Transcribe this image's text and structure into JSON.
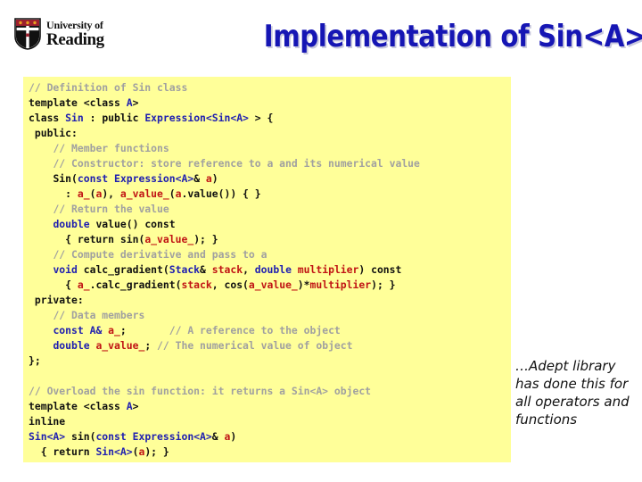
{
  "slide": {
    "title": "Implementation of Sin<A>",
    "title_color": "#1616b4",
    "title_shadow_color": "#c9c9dd",
    "background_color": "#ffffff"
  },
  "logo": {
    "name": "university-of-reading-logo",
    "line1": "University of",
    "line2": "Reading",
    "crest_colors": {
      "shield_red": "#9c1f2e",
      "shield_black": "#111111",
      "shield_white": "#ffffff",
      "gold": "#e8a020"
    }
  },
  "code_panel": {
    "background_color": "#ffff99",
    "language": "cpp",
    "colors": {
      "comment": "#a0a0a0",
      "keyword": "#101010",
      "type": "#2020b0",
      "variable": "#c01414"
    },
    "lines": [
      {
        "id": 1,
        "tokens": [
          {
            "t": "// Definition of Sin class",
            "c": "com"
          }
        ]
      },
      {
        "id": 2,
        "tokens": [
          {
            "t": "template ",
            "c": "kw"
          },
          {
            "t": "<class ",
            "c": "kw"
          },
          {
            "t": "A",
            "c": "type"
          },
          {
            "t": ">",
            "c": "kw"
          }
        ]
      },
      {
        "id": 3,
        "tokens": [
          {
            "t": "class ",
            "c": "kw"
          },
          {
            "t": "Sin",
            "c": "type"
          },
          {
            "t": " : ",
            "c": "kw"
          },
          {
            "t": "public ",
            "c": "kw"
          },
          {
            "t": "Expression<Sin<A>",
            "c": "type"
          },
          {
            "t": " > {",
            "c": "kw"
          }
        ]
      },
      {
        "id": 4,
        "tokens": [
          {
            "t": " public:",
            "c": "kw"
          }
        ]
      },
      {
        "id": 5,
        "tokens": [
          {
            "t": "    ",
            "c": "pl"
          },
          {
            "t": "// Member functions",
            "c": "com"
          }
        ]
      },
      {
        "id": 6,
        "tokens": [
          {
            "t": "    ",
            "c": "pl"
          },
          {
            "t": "// Constructor: store reference to a and its numerical value",
            "c": "com"
          }
        ]
      },
      {
        "id": 7,
        "tokens": [
          {
            "t": "    ",
            "c": "pl"
          },
          {
            "t": "Sin",
            "c": "kw"
          },
          {
            "t": "(",
            "c": "kw"
          },
          {
            "t": "const ",
            "c": "type"
          },
          {
            "t": "Expression<A>",
            "c": "type"
          },
          {
            "t": "& ",
            "c": "kw"
          },
          {
            "t": "a",
            "c": "var"
          },
          {
            "t": ")",
            "c": "kw"
          }
        ]
      },
      {
        "id": 8,
        "tokens": [
          {
            "t": "      : ",
            "c": "kw"
          },
          {
            "t": "a_",
            "c": "var"
          },
          {
            "t": "(",
            "c": "kw"
          },
          {
            "t": "a",
            "c": "var"
          },
          {
            "t": "), ",
            "c": "kw"
          },
          {
            "t": "a_value_",
            "c": "var"
          },
          {
            "t": "(",
            "c": "kw"
          },
          {
            "t": "a",
            "c": "var"
          },
          {
            "t": ".value()) { }",
            "c": "kw"
          }
        ]
      },
      {
        "id": 9,
        "tokens": [
          {
            "t": "    ",
            "c": "pl"
          },
          {
            "t": "// Return the value",
            "c": "com"
          }
        ]
      },
      {
        "id": 10,
        "tokens": [
          {
            "t": "    ",
            "c": "pl"
          },
          {
            "t": "double ",
            "c": "type"
          },
          {
            "t": "value() const",
            "c": "kw"
          }
        ]
      },
      {
        "id": 11,
        "tokens": [
          {
            "t": "      { return sin(",
            "c": "kw"
          },
          {
            "t": "a_value_",
            "c": "var"
          },
          {
            "t": "); }",
            "c": "kw"
          }
        ]
      },
      {
        "id": 12,
        "tokens": [
          {
            "t": "    ",
            "c": "pl"
          },
          {
            "t": "// Compute derivative and pass to a",
            "c": "com"
          }
        ]
      },
      {
        "id": 13,
        "tokens": [
          {
            "t": "    ",
            "c": "pl"
          },
          {
            "t": "void ",
            "c": "type"
          },
          {
            "t": "calc_gradient(",
            "c": "kw"
          },
          {
            "t": "Stack",
            "c": "type"
          },
          {
            "t": "& ",
            "c": "kw"
          },
          {
            "t": "stack",
            "c": "var"
          },
          {
            "t": ", ",
            "c": "kw"
          },
          {
            "t": "double ",
            "c": "type"
          },
          {
            "t": "multiplier",
            "c": "var"
          },
          {
            "t": ") const",
            "c": "kw"
          }
        ]
      },
      {
        "id": 14,
        "tokens": [
          {
            "t": "      { ",
            "c": "kw"
          },
          {
            "t": "a_",
            "c": "var"
          },
          {
            "t": ".calc_gradient(",
            "c": "kw"
          },
          {
            "t": "stack",
            "c": "var"
          },
          {
            "t": ", cos(",
            "c": "kw"
          },
          {
            "t": "a_value_",
            "c": "var"
          },
          {
            "t": ")*",
            "c": "kw"
          },
          {
            "t": "multiplier",
            "c": "var"
          },
          {
            "t": "); }",
            "c": "kw"
          }
        ]
      },
      {
        "id": 15,
        "tokens": [
          {
            "t": " private:",
            "c": "kw"
          }
        ]
      },
      {
        "id": 16,
        "tokens": [
          {
            "t": "    ",
            "c": "pl"
          },
          {
            "t": "// Data members",
            "c": "com"
          }
        ]
      },
      {
        "id": 17,
        "tokens": [
          {
            "t": "    ",
            "c": "pl"
          },
          {
            "t": "const ",
            "c": "type"
          },
          {
            "t": "A&",
            "c": "type"
          },
          {
            "t": " ",
            "c": "kw"
          },
          {
            "t": "a_",
            "c": "var"
          },
          {
            "t": ";",
            "c": "kw"
          },
          {
            "t": "       ",
            "c": "pl"
          },
          {
            "t": "// A reference to the object",
            "c": "com"
          }
        ]
      },
      {
        "id": 18,
        "tokens": [
          {
            "t": "    ",
            "c": "pl"
          },
          {
            "t": "double ",
            "c": "type"
          },
          {
            "t": "a_value_",
            "c": "var"
          },
          {
            "t": "; ",
            "c": "kw"
          },
          {
            "t": "// The numerical value of object",
            "c": "com"
          }
        ]
      },
      {
        "id": 19,
        "tokens": [
          {
            "t": "};",
            "c": "kw"
          }
        ]
      },
      {
        "id": 20,
        "tokens": []
      },
      {
        "id": 21,
        "tokens": [
          {
            "t": "// Overload the sin function: it returns a Sin<A> object",
            "c": "com"
          }
        ]
      },
      {
        "id": 22,
        "tokens": [
          {
            "t": "template ",
            "c": "kw"
          },
          {
            "t": "<class ",
            "c": "kw"
          },
          {
            "t": "A",
            "c": "type"
          },
          {
            "t": ">",
            "c": "kw"
          }
        ]
      },
      {
        "id": 23,
        "tokens": [
          {
            "t": "inline",
            "c": "kw"
          }
        ]
      },
      {
        "id": 24,
        "tokens": [
          {
            "t": "Sin<A>",
            "c": "type"
          },
          {
            "t": " sin(",
            "c": "kw"
          },
          {
            "t": "const ",
            "c": "type"
          },
          {
            "t": "Expression<A>",
            "c": "type"
          },
          {
            "t": "& ",
            "c": "kw"
          },
          {
            "t": "a",
            "c": "var"
          },
          {
            "t": ")",
            "c": "kw"
          }
        ]
      },
      {
        "id": 25,
        "tokens": [
          {
            "t": "  { return ",
            "c": "kw"
          },
          {
            "t": "Sin<A>",
            "c": "type"
          },
          {
            "t": "(",
            "c": "kw"
          },
          {
            "t": "a",
            "c": "var"
          },
          {
            "t": "); }",
            "c": "kw"
          }
        ]
      }
    ]
  },
  "note": {
    "text": "…Adept library has done this for all operators and functions"
  }
}
